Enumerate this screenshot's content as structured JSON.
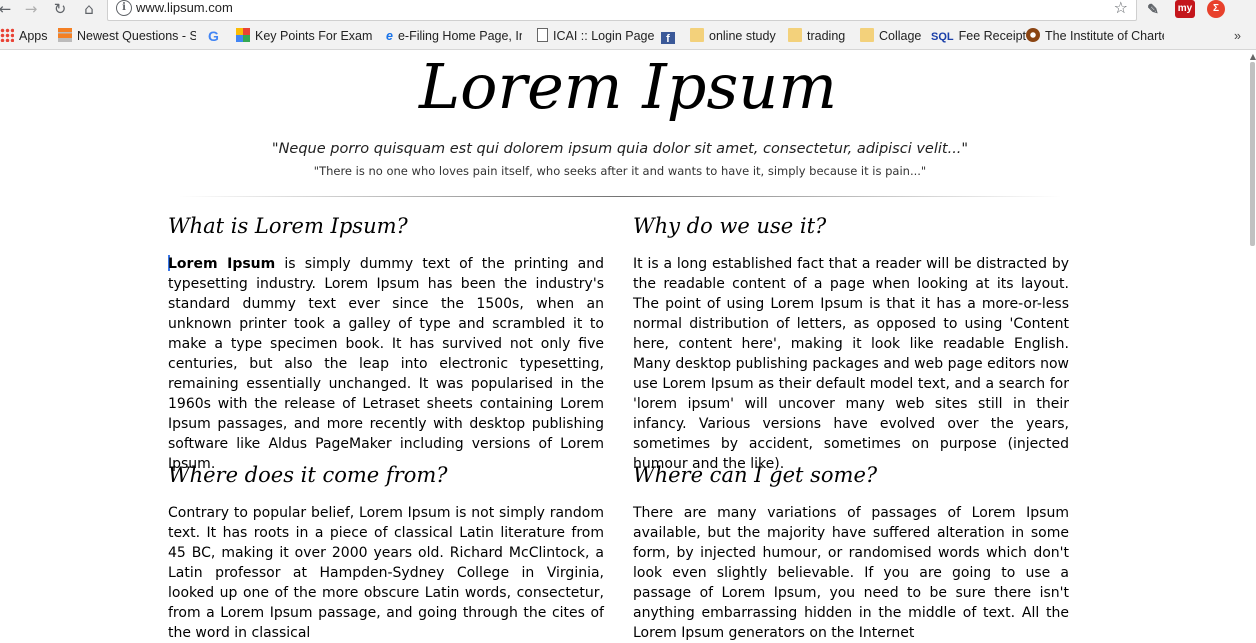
{
  "browser": {
    "url": "www.lipsum.com"
  },
  "bookmarks": [
    {
      "label": "Apps",
      "icon": "apps-grid-icon"
    },
    {
      "label": "Newest Questions - St",
      "icon": "stackexchange-icon"
    },
    {
      "label": "",
      "icon": "google-icon"
    },
    {
      "label": "Key Points For Exam p",
      "icon": "grid-icon"
    },
    {
      "label": "e-Filing Home Page, In",
      "icon": "ie-icon"
    },
    {
      "label": "ICAI :: Login Page",
      "icon": "page-icon"
    },
    {
      "label": "",
      "icon": "facebook-icon"
    },
    {
      "label": "online study",
      "icon": "folder-icon"
    },
    {
      "label": "trading",
      "icon": "folder-icon"
    },
    {
      "label": "Collage",
      "icon": "folder-icon"
    },
    {
      "label": "Fee Receipt",
      "icon": "sql-icon"
    },
    {
      "label": "The Institute of Charte",
      "icon": "institute-icon"
    }
  ],
  "page": {
    "logo": "Lorem Ipsum",
    "quote_latin": "\"Neque porro quisquam est qui dolorem ipsum quia dolor sit amet, consectetur, adipisci velit...\"",
    "quote_english": "\"There is no one who loves pain itself, who seeks after it and wants to have it, simply because it is pain...\"",
    "sections": {
      "what": {
        "heading": "What is Lorem Ipsum?",
        "bold": "Lorem Ipsum",
        "body": " is simply dummy text of the printing and typesetting industry. Lorem Ipsum has been the industry's standard dummy text ever since the 1500s, when an unknown printer took a galley of type and scrambled it to make a type specimen book. It has survived not only five centuries, but also the leap into electronic typesetting, remaining essentially unchanged. It was popularised in the 1960s with the release of Letraset sheets containing Lorem Ipsum passages, and more recently with desktop publishing software like Aldus PageMaker including versions of Lorem Ipsum."
      },
      "why": {
        "heading": "Why do we use it?",
        "body": "It is a long established fact that a reader will be distracted by the readable content of a page when looking at its layout. The point of using Lorem Ipsum is that it has a more-or-less normal distribution of letters, as opposed to using 'Content here, content here', making it look like readable English. Many desktop publishing packages and web page editors now use Lorem Ipsum as their default model text, and a search for 'lorem ipsum' will uncover many web sites still in their infancy. Various versions have evolved over the years, sometimes by accident, sometimes on purpose (injected humour and the like)."
      },
      "where_from": {
        "heading": "Where does it come from?",
        "body": "Contrary to popular belief, Lorem Ipsum is not simply random text. It has roots in a piece of classical Latin literature from 45 BC, making it over 2000 years old. Richard McClintock, a Latin professor at Hampden-Sydney College in Virginia, looked up one of the more obscure Latin words, consectetur, from a Lorem Ipsum passage, and going through the cites of the word in classical"
      },
      "where_get": {
        "heading": "Where can I get some?",
        "body": "There are many variations of passages of Lorem Ipsum available, but the majority have suffered alteration in some form, by injected humour, or randomised words which don't look even slightly believable. If you are going to use a passage of Lorem Ipsum, you need to be sure there isn't anything embarrassing hidden in the middle of text. All the Lorem Ipsum generators on the Internet"
      }
    }
  },
  "colors": {
    "chrome_bg": "#f2f2f2",
    "selection_cursor": "#3b78e7"
  }
}
